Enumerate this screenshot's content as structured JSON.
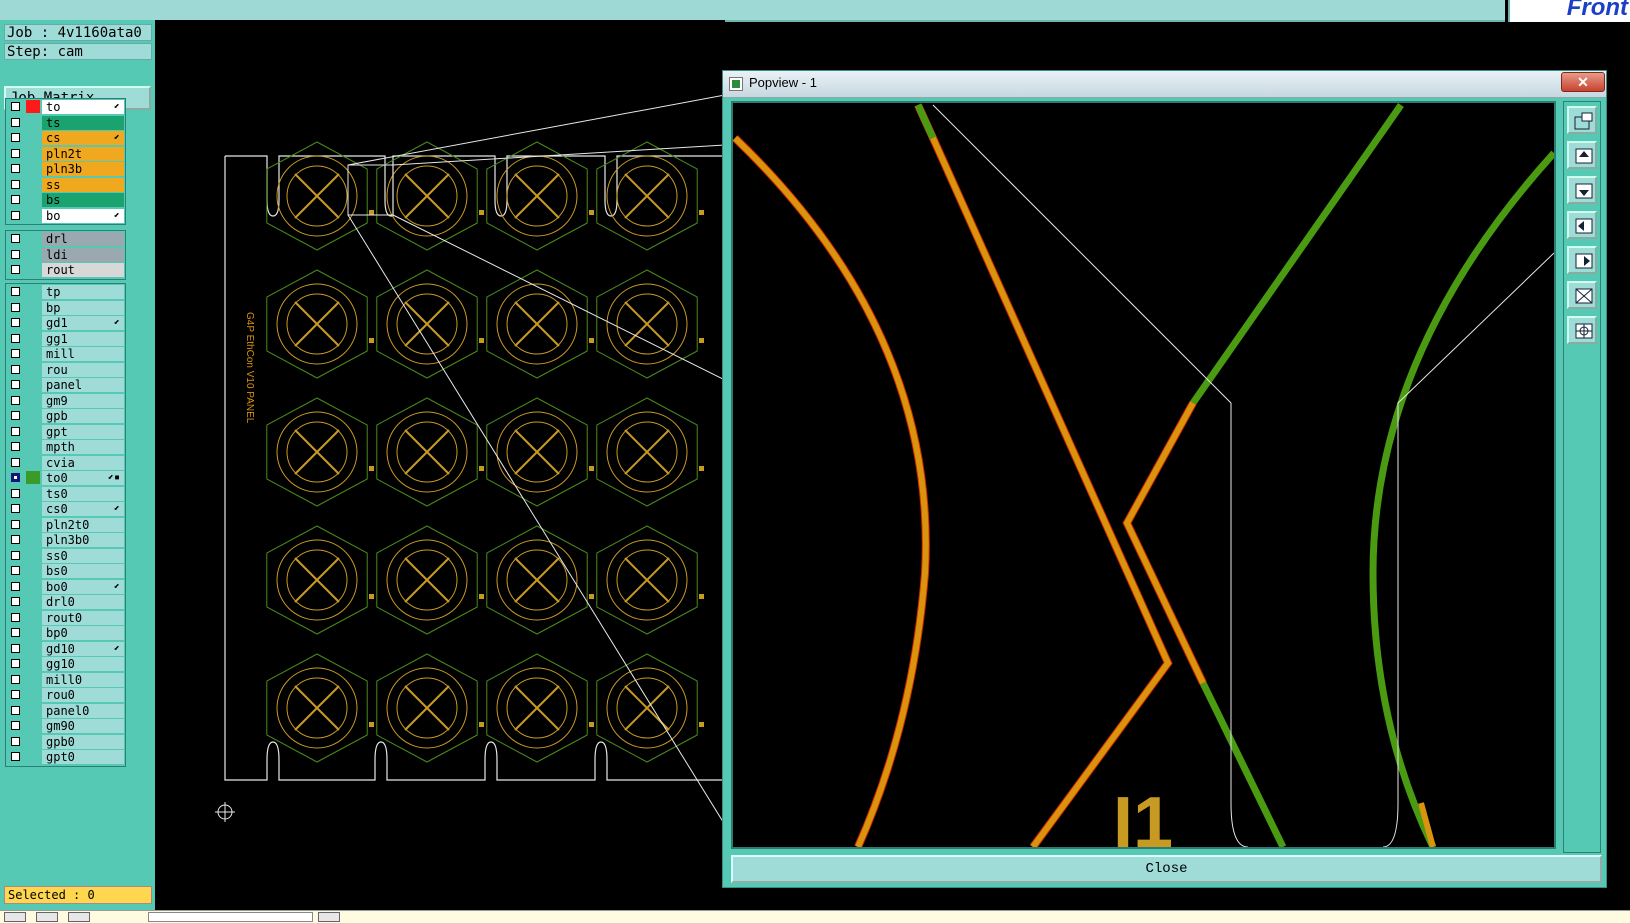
{
  "header": {
    "logo_text": "Front"
  },
  "info": {
    "job": "Job : 4v1160ata0",
    "step": "Step: cam"
  },
  "job_matrix_label": "Job Matrix ...",
  "layer_groups": [
    [
      {
        "name": "to",
        "color": "#ffffff",
        "flag": "#ff1a1a",
        "mark": "⬋"
      },
      {
        "name": "ts",
        "color": "#1aa36f",
        "flag": "",
        "mark": ""
      },
      {
        "name": "cs",
        "color": "#f0a91f",
        "flag": "",
        "mark": "⬋"
      },
      {
        "name": "pln2t",
        "color": "#f0a91f",
        "flag": "",
        "mark": ""
      },
      {
        "name": "pln3b",
        "color": "#f0a91f",
        "flag": "",
        "mark": ""
      },
      {
        "name": "ss",
        "color": "#f0a91f",
        "flag": "",
        "mark": ""
      },
      {
        "name": "bs",
        "color": "#1aa36f",
        "flag": "",
        "mark": ""
      },
      {
        "name": "bo",
        "color": "#ffffff",
        "flag": "",
        "mark": "⬋"
      }
    ],
    [
      {
        "name": "drl",
        "color": "#9aa8b0",
        "flag": "",
        "mark": ""
      },
      {
        "name": "ldi",
        "color": "#9aa8b0",
        "flag": "",
        "mark": ""
      },
      {
        "name": "rout",
        "color": "#d8d8d8",
        "flag": "",
        "mark": ""
      }
    ],
    [
      {
        "name": "tp",
        "color": "#9fdcd8",
        "flag": "",
        "mark": ""
      },
      {
        "name": "bp",
        "color": "#9fdcd8",
        "flag": "",
        "mark": ""
      },
      {
        "name": "gd1",
        "color": "#9fdcd8",
        "flag": "",
        "mark": "⬋"
      },
      {
        "name": "gg1",
        "color": "#9fdcd8",
        "flag": "",
        "mark": ""
      },
      {
        "name": "mill",
        "color": "#9fdcd8",
        "flag": "",
        "mark": ""
      },
      {
        "name": "rou",
        "color": "#9fdcd8",
        "flag": "",
        "mark": ""
      },
      {
        "name": "panel",
        "color": "#9fdcd8",
        "flag": "",
        "mark": ""
      },
      {
        "name": "gm9",
        "color": "#9fdcd8",
        "flag": "",
        "mark": ""
      },
      {
        "name": "gpb",
        "color": "#9fdcd8",
        "flag": "",
        "mark": ""
      },
      {
        "name": "gpt",
        "color": "#9fdcd8",
        "flag": "",
        "mark": ""
      },
      {
        "name": "mpth",
        "color": "#9fdcd8",
        "flag": "",
        "mark": ""
      },
      {
        "name": "cvia",
        "color": "#9fdcd8",
        "flag": "",
        "mark": ""
      },
      {
        "name": "to0",
        "color": "#9fdcd8",
        "flag": "#3a9a2a",
        "mark": "⬋▪",
        "active": true
      },
      {
        "name": "ts0",
        "color": "#9fdcd8",
        "flag": "",
        "mark": ""
      },
      {
        "name": "cs0",
        "color": "#9fdcd8",
        "flag": "",
        "mark": "⬋"
      },
      {
        "name": "pln2t0",
        "color": "#9fdcd8",
        "flag": "",
        "mark": ""
      },
      {
        "name": "pln3b0",
        "color": "#9fdcd8",
        "flag": "",
        "mark": ""
      },
      {
        "name": "ss0",
        "color": "#9fdcd8",
        "flag": "",
        "mark": ""
      },
      {
        "name": "bs0",
        "color": "#9fdcd8",
        "flag": "",
        "mark": ""
      },
      {
        "name": "bo0",
        "color": "#9fdcd8",
        "flag": "",
        "mark": "⬋"
      },
      {
        "name": "drl0",
        "color": "#9fdcd8",
        "flag": "",
        "mark": ""
      },
      {
        "name": "rout0",
        "color": "#9fdcd8",
        "flag": "",
        "mark": ""
      },
      {
        "name": "bp0",
        "color": "#9fdcd8",
        "flag": "",
        "mark": ""
      },
      {
        "name": "gd10",
        "color": "#9fdcd8",
        "flag": "",
        "mark": "⬋"
      },
      {
        "name": "gg10",
        "color": "#9fdcd8",
        "flag": "",
        "mark": ""
      },
      {
        "name": "mill0",
        "color": "#9fdcd8",
        "flag": "",
        "mark": ""
      },
      {
        "name": "rou0",
        "color": "#9fdcd8",
        "flag": "",
        "mark": ""
      },
      {
        "name": "panel0",
        "color": "#9fdcd8",
        "flag": "",
        "mark": ""
      },
      {
        "name": "gm90",
        "color": "#9fdcd8",
        "flag": "",
        "mark": ""
      },
      {
        "name": "gpb0",
        "color": "#9fdcd8",
        "flag": "",
        "mark": ""
      },
      {
        "name": "gpt0",
        "color": "#9fdcd8",
        "flag": "",
        "mark": ""
      }
    ]
  ],
  "selected_label": "Selected : 0",
  "board": {
    "panel_label": "G4P EthCon V10 PANEL",
    "grid_cols": 4,
    "grid_rows": 5
  },
  "popview": {
    "title": "Popview - 1",
    "close_x": "✕",
    "close_button": "Close",
    "zoom_text": "_I1",
    "tool_icons": [
      "zoom-window-icon",
      "pan-up-icon",
      "pan-down-icon",
      "pan-left-icon",
      "pan-right-icon",
      "zoom-fit-icon",
      "zoom-home-icon"
    ]
  },
  "colors": {
    "trace_orange": "#d9930c",
    "trace_green": "#4a9a12",
    "trace_red_edge": "#d22a00",
    "outline_white": "#e8e8e8",
    "pad_yellow": "#c79a22",
    "pad_green": "#4b8a1d"
  }
}
